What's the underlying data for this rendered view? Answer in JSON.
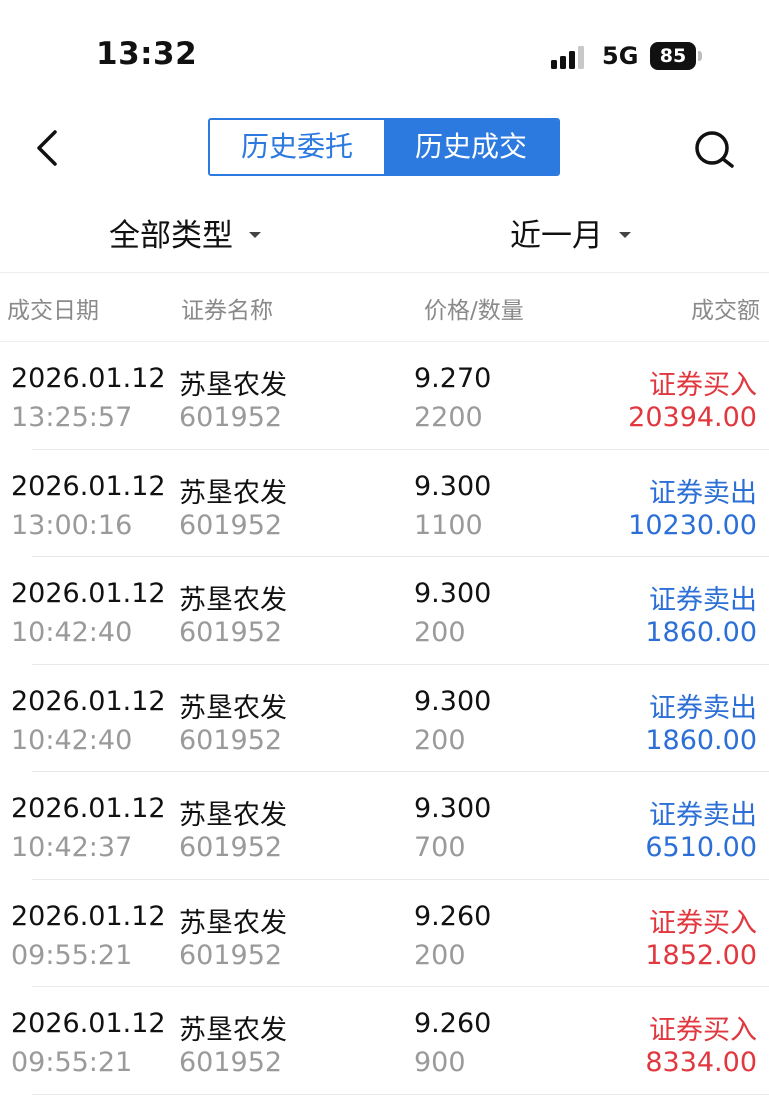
{
  "status_bar": {
    "time": "13:32",
    "network": "5G",
    "battery": "85"
  },
  "nav": {
    "tabs": [
      {
        "label": "历史委托",
        "active": false
      },
      {
        "label": "历史成交",
        "active": true
      }
    ]
  },
  "filters": {
    "type": "全部类型",
    "period": "近一月"
  },
  "table": {
    "headers": {
      "date": "成交日期",
      "name": "证券名称",
      "price_qty": "价格/数量",
      "amount": "成交额"
    },
    "rows": [
      {
        "date": "2026.01.12",
        "time": "13:25:57",
        "name": "苏垦农发",
        "code": "601952",
        "price": "9.270",
        "qty": "2200",
        "action": "证券买入",
        "amount": "20394.00",
        "side": "buy"
      },
      {
        "date": "2026.01.12",
        "time": "13:00:16",
        "name": "苏垦农发",
        "code": "601952",
        "price": "9.300",
        "qty": "1100",
        "action": "证券卖出",
        "amount": "10230.00",
        "side": "sell"
      },
      {
        "date": "2026.01.12",
        "time": "10:42:40",
        "name": "苏垦农发",
        "code": "601952",
        "price": "9.300",
        "qty": "200",
        "action": "证券卖出",
        "amount": "1860.00",
        "side": "sell"
      },
      {
        "date": "2026.01.12",
        "time": "10:42:40",
        "name": "苏垦农发",
        "code": "601952",
        "price": "9.300",
        "qty": "200",
        "action": "证券卖出",
        "amount": "1860.00",
        "side": "sell"
      },
      {
        "date": "2026.01.12",
        "time": "10:42:37",
        "name": "苏垦农发",
        "code": "601952",
        "price": "9.300",
        "qty": "700",
        "action": "证券卖出",
        "amount": "6510.00",
        "side": "sell"
      },
      {
        "date": "2026.01.12",
        "time": "09:55:21",
        "name": "苏垦农发",
        "code": "601952",
        "price": "9.260",
        "qty": "200",
        "action": "证券买入",
        "amount": "1852.00",
        "side": "buy"
      },
      {
        "date": "2026.01.12",
        "time": "09:55:21",
        "name": "苏垦农发",
        "code": "601952",
        "price": "9.260",
        "qty": "900",
        "action": "证券买入",
        "amount": "8334.00",
        "side": "buy"
      }
    ]
  },
  "colors": {
    "accent": "#2c79e0",
    "buy": "#e0383e",
    "sell": "#2c6fd6"
  },
  "icons": {
    "back": "chevron-left-icon",
    "search": "search-icon"
  }
}
